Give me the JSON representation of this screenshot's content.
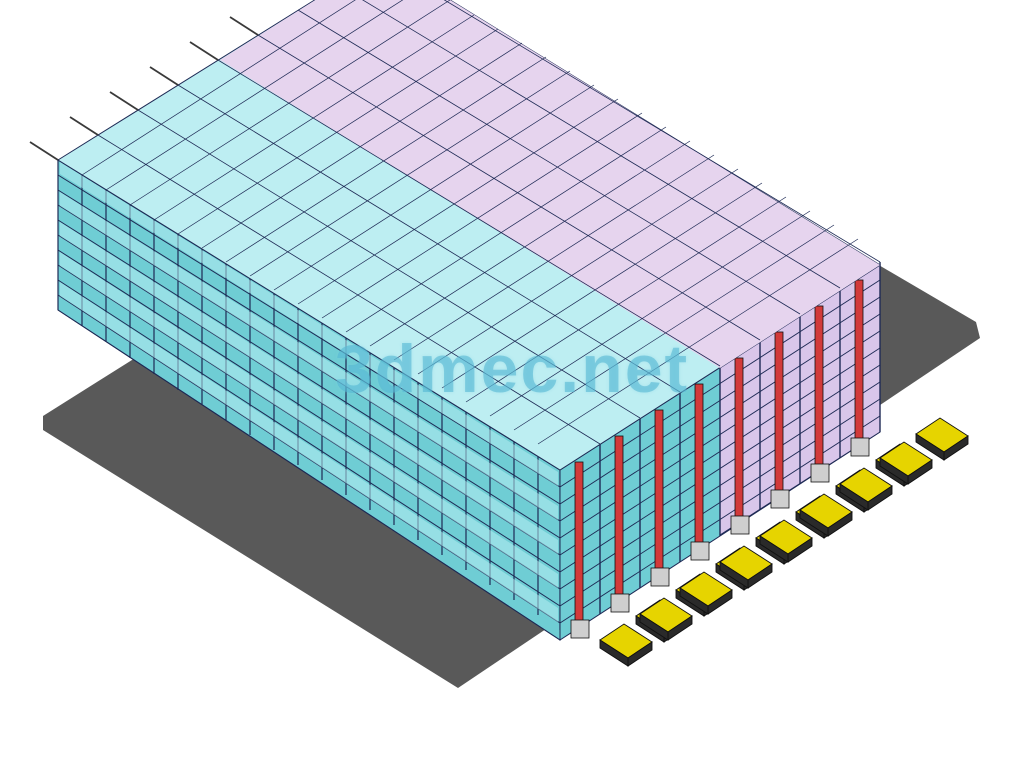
{
  "watermark": {
    "text": "3dmec.net"
  },
  "model": {
    "description": "Automated high-bay warehouse / AS-RS racking system, isometric CAD render",
    "floor_color": "#595959",
    "rack_levels": 10,
    "rack_bays_long_side": 22,
    "aisles": 8,
    "stacker_cranes": 8,
    "left_zone_color": "#9fe3e8",
    "right_zone_color": "#e6d4ee",
    "crane_accent_color": "#d23a3a",
    "frame_color": "#2a2a55",
    "conveyor_top_color": "#e6d400",
    "conveyor_frame_color": "#2a2a2a"
  }
}
